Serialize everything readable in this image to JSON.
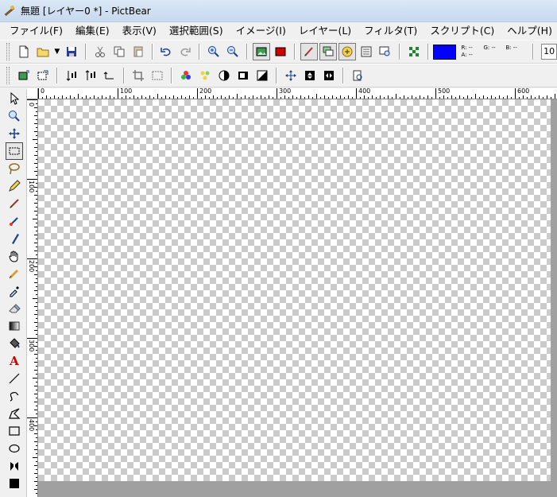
{
  "window": {
    "title": "無題 [レイヤー0 *] - PictBear"
  },
  "menu": [
    "ファイル(F)",
    "編集(E)",
    "表示(V)",
    "選択範囲(S)",
    "イメージ(I)",
    "レイヤー(L)",
    "フィルタ(T)",
    "スクリプト(C)",
    "ヘルプ(H)"
  ],
  "toolbar1": {
    "buttons": [
      "new-file-icon",
      "open-folder-icon",
      "save-icon",
      "cut-icon",
      "copy-icon",
      "paste-icon",
      "undo-icon",
      "redo-icon",
      "zoom-in-icon",
      "zoom-out-icon",
      "image-window-icon",
      "color-window-icon",
      "brush-palette-icon",
      "layer-palette-icon",
      "navigator-icon",
      "history-icon",
      "preview-icon",
      "snap-grid-icon"
    ],
    "color": {
      "hex": "#0000ff",
      "r": "R: --",
      "g": "G: --",
      "b": "B: --",
      "a": "A: --"
    },
    "zoom_value": "10"
  },
  "toolbar2": {
    "buttons": [
      "canvas-size-icon",
      "image-size-icon",
      "flip-horizontal-icon",
      "flip-vertical-icon",
      "rotate-icon",
      "crop-icon",
      "select-all-icon",
      "color-balance-icon",
      "hue-icon",
      "brightness-icon",
      "levels-icon",
      "contrast-icon",
      "move-icon",
      "rotate-180-icon",
      "mirror-icon",
      "info-icon"
    ]
  },
  "tools": [
    "pointer-icon",
    "magnifier-icon",
    "move-tool-icon",
    "rect-select-icon",
    "lasso-icon",
    "pencil-icon",
    "brush-icon",
    "airbrush-icon",
    "pen-icon",
    "hand-icon",
    "smudge-icon",
    "eyedropper-icon",
    "eraser-icon",
    "gradient-icon",
    "fill-icon",
    "text-icon",
    "line-icon",
    "curve-icon",
    "polyline-icon",
    "rectangle-icon",
    "ellipse-icon",
    "stamp-icon",
    "foreground-color-icon"
  ],
  "ruler": {
    "h_labels": [
      "0",
      "100",
      "200",
      "300",
      "400",
      "500",
      "600"
    ],
    "v_labels": [
      "0",
      "100",
      "200",
      "300",
      "400"
    ]
  }
}
